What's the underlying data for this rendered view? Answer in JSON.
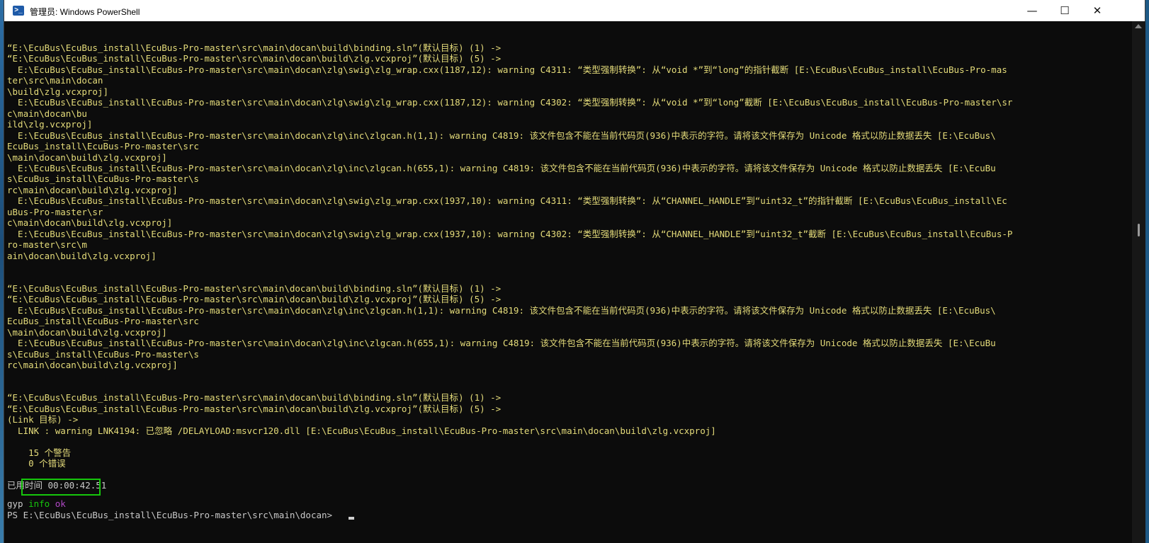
{
  "window": {
    "title": "管理员: Windows PowerShell",
    "app_icon": "powershell-icon",
    "minimize_icon": "minimize-icon",
    "maximize_icon": "maximize-icon",
    "close_icon": "close-icon"
  },
  "console": {
    "lines": [
      "“E:\\EcuBus\\EcuBus_install\\EcuBus-Pro-master\\src\\main\\docan\\build\\binding.sln”(默认目标) (1) ->",
      "“E:\\EcuBus\\EcuBus_install\\EcuBus-Pro-master\\src\\main\\docan\\build\\zlg.vcxproj”(默认目标) (5) ->",
      "  E:\\EcuBus\\EcuBus_install\\EcuBus-Pro-master\\src\\main\\docan\\zlg\\swig\\zlg_wrap.cxx(1187,12): warning C4311: “类型强制转换”: 从“void *”到“long”的指针截断 [E:\\EcuBus\\EcuBus_install\\EcuBus-Pro-mas",
      "ter\\src\\main\\docan",
      "\\build\\zlg.vcxproj]",
      "  E:\\EcuBus\\EcuBus_install\\EcuBus-Pro-master\\src\\main\\docan\\zlg\\swig\\zlg_wrap.cxx(1187,12): warning C4302: “类型强制转换”: 从“void *”到“long”截断 [E:\\EcuBus\\EcuBus_install\\EcuBus-Pro-master\\sr",
      "c\\main\\docan\\bu",
      "ild\\zlg.vcxproj]",
      "  E:\\EcuBus\\EcuBus_install\\EcuBus-Pro-master\\src\\main\\docan\\zlg\\inc\\zlgcan.h(1,1): warning C4819: 该文件包含不能在当前代码页(936)中表示的字符。请将该文件保存为 Unicode 格式以防止数据丢失 [E:\\EcuBus\\",
      "EcuBus_install\\EcuBus-Pro-master\\src",
      "\\main\\docan\\build\\zlg.vcxproj]",
      "  E:\\EcuBus\\EcuBus_install\\EcuBus-Pro-master\\src\\main\\docan\\zlg\\inc\\zlgcan.h(655,1): warning C4819: 该文件包含不能在当前代码页(936)中表示的字符。请将该文件保存为 Unicode 格式以防止数据丢失 [E:\\EcuBu",
      "s\\EcuBus_install\\EcuBus-Pro-master\\s",
      "rc\\main\\docan\\build\\zlg.vcxproj]",
      "  E:\\EcuBus\\EcuBus_install\\EcuBus-Pro-master\\src\\main\\docan\\zlg\\swig\\zlg_wrap.cxx(1937,10): warning C4311: “类型强制转换”: 从“CHANNEL_HANDLE”到“uint32_t”的指针截断 [E:\\EcuBus\\EcuBus_install\\Ec",
      "uBus-Pro-master\\sr",
      "c\\main\\docan\\build\\zlg.vcxproj]",
      "  E:\\EcuBus\\EcuBus_install\\EcuBus-Pro-master\\src\\main\\docan\\zlg\\swig\\zlg_wrap.cxx(1937,10): warning C4302: “类型强制转换”: 从“CHANNEL_HANDLE”到“uint32_t”截断 [E:\\EcuBus\\EcuBus_install\\EcuBus-P",
      "ro-master\\src\\m",
      "ain\\docan\\build\\zlg.vcxproj]",
      "",
      "",
      "“E:\\EcuBus\\EcuBus_install\\EcuBus-Pro-master\\src\\main\\docan\\build\\binding.sln”(默认目标) (1) ->",
      "“E:\\EcuBus\\EcuBus_install\\EcuBus-Pro-master\\src\\main\\docan\\build\\zlg.vcxproj”(默认目标) (5) ->",
      "  E:\\EcuBus\\EcuBus_install\\EcuBus-Pro-master\\src\\main\\docan\\zlg\\inc\\zlgcan.h(1,1): warning C4819: 该文件包含不能在当前代码页(936)中表示的字符。请将该文件保存为 Unicode 格式以防止数据丢失 [E:\\EcuBus\\",
      "EcuBus_install\\EcuBus-Pro-master\\src",
      "\\main\\docan\\build\\zlg.vcxproj]",
      "  E:\\EcuBus\\EcuBus_install\\EcuBus-Pro-master\\src\\main\\docan\\zlg\\inc\\zlgcan.h(655,1): warning C4819: 该文件包含不能在当前代码页(936)中表示的字符。请将该文件保存为 Unicode 格式以防止数据丢失 [E:\\EcuBu",
      "s\\EcuBus_install\\EcuBus-Pro-master\\s",
      "rc\\main\\docan\\build\\zlg.vcxproj]",
      "",
      "",
      "“E:\\EcuBus\\EcuBus_install\\EcuBus-Pro-master\\src\\main\\docan\\build\\binding.sln”(默认目标) (1) ->",
      "“E:\\EcuBus\\EcuBus_install\\EcuBus-Pro-master\\src\\main\\docan\\build\\zlg.vcxproj”(默认目标) (5) ->",
      "(Link 目标) ->",
      "  LINK : warning LNK4194: 已忽略 /DELAYLOAD:msvcr120.dll [E:\\EcuBus\\EcuBus_install\\EcuBus-Pro-master\\src\\main\\docan\\build\\zlg.vcxproj]",
      "",
      "    15 个警告",
      "    0 个错误",
      "",
      "已用时间 00:00:42.51"
    ],
    "gyp_prefix": "gyp ",
    "gyp_info": "info",
    "gyp_ok": "ok",
    "prompt": "PS E:\\EcuBus\\EcuBus_install\\EcuBus-Pro-master\\src\\main\\docan> ",
    "colors": {
      "background": "#0c0c0c",
      "warning_text": "#e5dc7a",
      "normal_text": "#c9c9c9",
      "info_green": "#16c60c",
      "ok_magenta": "#b148c6",
      "highlight_border": "#16c60c"
    }
  }
}
